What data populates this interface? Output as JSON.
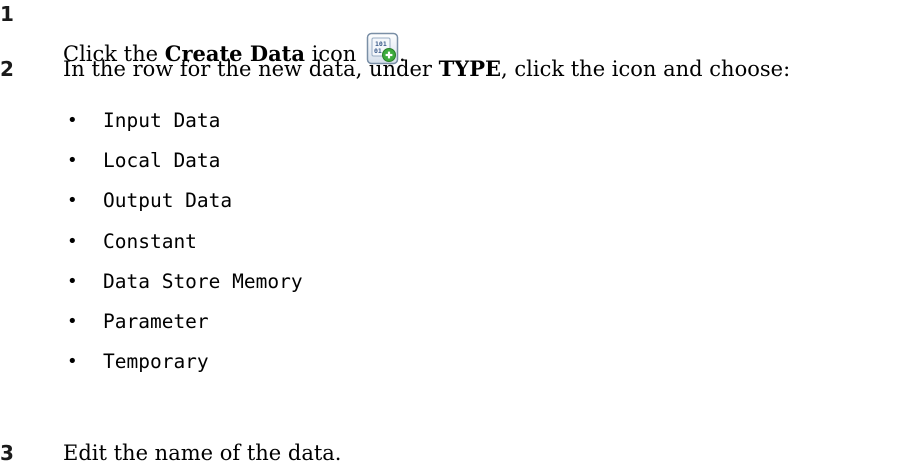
{
  "steps": [
    {
      "number": "1",
      "prefix": "Click the ",
      "bold": "Create Data",
      "suffix": " icon ",
      "trailing": "."
    },
    {
      "number": "2",
      "prefix": "In the row for the new data, under ",
      "bold": "TYPE",
      "suffix": ", click the icon and choose:"
    },
    {
      "number": "3",
      "text": "Edit the name of the data."
    }
  ],
  "type_options": [
    "Input Data",
    "Local Data",
    "Output Data",
    "Constant",
    "Data Store Memory",
    "Parameter",
    "Temporary"
  ],
  "bullet_glyph": "•",
  "icons": {
    "create_data": "create-data-icon"
  },
  "colors": {
    "icon_border": "#7a8fa6",
    "icon_fill": "#e8eef6",
    "icon_binary": "#3a5a8a",
    "icon_plus": "#3cab3c"
  }
}
